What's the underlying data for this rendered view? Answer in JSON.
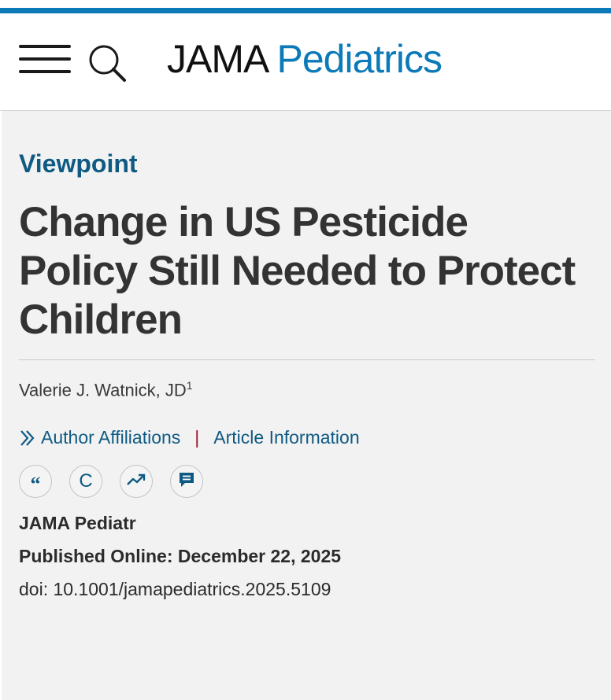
{
  "header": {
    "logo_part1": "JAMA",
    "logo_part2": "Pediatrics",
    "menu_icon": "hamburger-menu-icon",
    "search_icon": "search-icon"
  },
  "article": {
    "section_label": "Viewpoint",
    "title": "Change in US Pesticide Policy Still Needed to Protect Children",
    "author": "Valerie J. Watnick, JD",
    "author_superscript": "1",
    "links": {
      "author_affiliations": "Author Affiliations",
      "separator": "|",
      "article_information": "Article Information"
    },
    "action_icons": [
      {
        "name": "cite-quote-icon",
        "glyph": "“"
      },
      {
        "name": "permissions-icon",
        "glyph": "C"
      },
      {
        "name": "metrics-icon",
        "glyph": ""
      },
      {
        "name": "comment-icon",
        "glyph": ""
      }
    ],
    "journal": "JAMA Pediatr",
    "published_online": "Published Online: December 22, 2025",
    "doi": "doi: 10.1001/jamapediatrics.2025.5109"
  },
  "colors": {
    "brand_blue": "#0c7ab8",
    "link_blue": "#0e5a83",
    "separator_red": "#a0142f",
    "background": "#f2f2f2"
  }
}
